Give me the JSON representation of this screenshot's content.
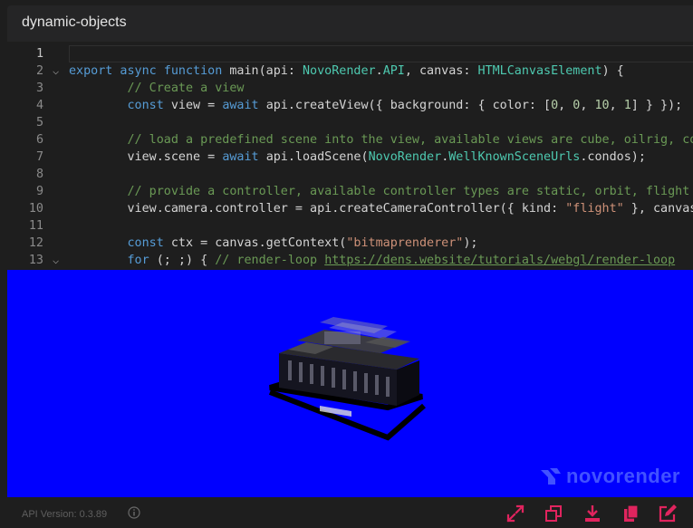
{
  "window": {
    "title": "dynamic-objects"
  },
  "editor": {
    "line_numbers": [
      "1",
      "2",
      "3",
      "4",
      "5",
      "6",
      "7",
      "8",
      "9",
      "10",
      "11",
      "12",
      "13"
    ],
    "lines": [
      [],
      [
        [
          "kw",
          "export async function "
        ],
        [
          "tx",
          "main(api: "
        ],
        [
          "ty",
          "NovoRender"
        ],
        [
          "tx",
          "."
        ],
        [
          "ty",
          "API"
        ],
        [
          "tx",
          ", canvas: "
        ],
        [
          "ty",
          "HTMLCanvasElement"
        ],
        [
          "tx",
          ") {"
        ]
      ],
      [
        [
          "cm",
          "        // Create a view"
        ]
      ],
      [
        [
          "kw",
          "        const "
        ],
        [
          "tx",
          "view = "
        ],
        [
          "kw",
          "await "
        ],
        [
          "tx",
          "api.createView({ background: { color: ["
        ],
        [
          "nm",
          "0"
        ],
        [
          "tx",
          ", "
        ],
        [
          "nm",
          "0"
        ],
        [
          "tx",
          ", "
        ],
        [
          "nm",
          "10"
        ],
        [
          "tx",
          ", "
        ],
        [
          "nm",
          "1"
        ],
        [
          "tx",
          "] } });"
        ]
      ],
      [],
      [
        [
          "cm",
          "        // load a predefined scene into the view, available views are cube, oilrig, condos"
        ]
      ],
      [
        [
          "tx",
          "        view.scene = "
        ],
        [
          "kw",
          "await "
        ],
        [
          "tx",
          "api.loadScene("
        ],
        [
          "ty",
          "NovoRender"
        ],
        [
          "tx",
          "."
        ],
        [
          "ty",
          "WellKnownSceneUrls"
        ],
        [
          "tx",
          ".condos);"
        ]
      ],
      [],
      [
        [
          "cm",
          "        // provide a controller, available controller types are static, orbit, flight"
        ]
      ],
      [
        [
          "tx",
          "        view.camera.controller = api.createCameraController({ kind: "
        ],
        [
          "st",
          "\"flight\""
        ],
        [
          "tx",
          " }, canvas);"
        ]
      ],
      [],
      [
        [
          "kw",
          "        const "
        ],
        [
          "tx",
          "ctx = canvas.getContext("
        ],
        [
          "st",
          "\"bitmaprenderer\""
        ],
        [
          "tx",
          ");"
        ]
      ],
      [
        [
          "kw",
          "        for "
        ],
        [
          "tx",
          "(; ;) { "
        ],
        [
          "cm",
          "// render-loop "
        ],
        [
          "cmurl",
          "https://dens.website/tutorials/webgl/render-loop"
        ]
      ]
    ],
    "fold_marker": "⌵"
  },
  "viewport": {
    "logo_text": "novorender",
    "background": "#0000ff"
  },
  "status": {
    "version": "API Version: 0.3.89"
  },
  "icons": [
    "info-icon",
    "expand-icon",
    "restore-window-icon",
    "download-icon",
    "copy-icon",
    "edit-icon"
  ],
  "accent": "#e0245e"
}
